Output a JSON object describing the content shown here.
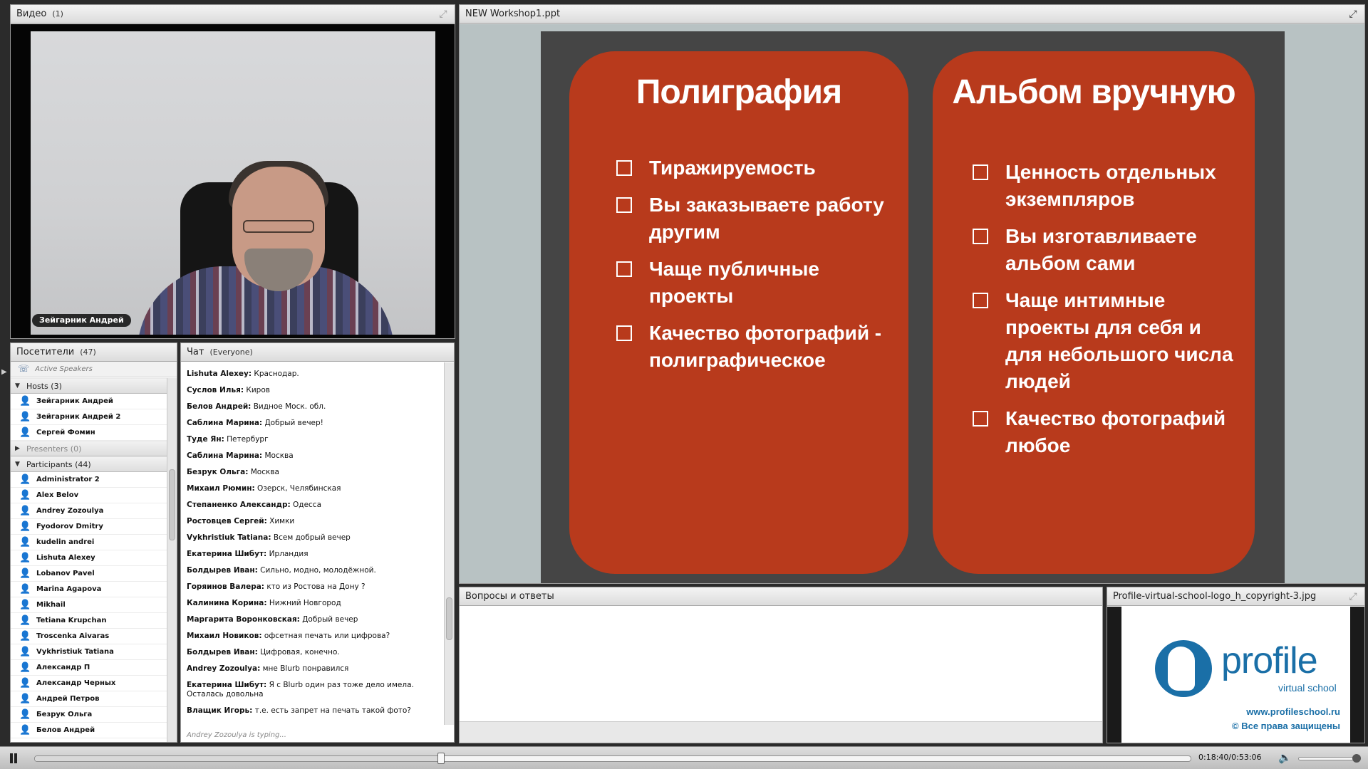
{
  "video": {
    "title": "Видео",
    "count": "(1)",
    "speaker_name": "Зейгарник Андрей"
  },
  "share": {
    "title": "NEW Workshop1.ppt",
    "slide": {
      "left_title": "Полиграфия",
      "left_items": [
        "Тиражируемость",
        "Вы заказываете работу другим",
        "Чаще публичные проекты",
        "Качество фотографий - полиграфическое"
      ],
      "right_title": "Альбом вручную",
      "right_items": [
        "Ценность отдельных экземпляров",
        "Вы изготавливаете альбом сами",
        "Чаще интимные проекты для себя и для небольшого числа людей",
        "Качество фотографий любое"
      ],
      "card_color": "#b83a1c"
    }
  },
  "attendees": {
    "title": "Посетители",
    "count": "(47)",
    "active_speakers": "Active Speakers",
    "hosts_label": "Hosts (3)",
    "hosts": [
      "Зейгарник Андрей",
      "Зейгарник Андрей 2",
      "Сергей Фомин"
    ],
    "presenters_label": "Presenters (0)",
    "participants_label": "Participants (44)",
    "participants": [
      "Administrator 2",
      "Alex Belov",
      "Andrey Zozoulya",
      "Fyodorov Dmitry",
      "kudelin andrei",
      "Lishuta Alexey",
      "Lobanov Pavel",
      "Marina Agapova",
      "Mikhail",
      "Tetiana Krupchan",
      "Troscenka Aivaras",
      "Vykhristiuk Tatiana",
      "Александр П",
      "Александр Черных",
      "Андрей Петров",
      "Безрук Ольга",
      "Белов Андрей"
    ]
  },
  "chat": {
    "title": "Чат",
    "scope": "(Everyone)",
    "messages": [
      {
        "author": "Lishuta Alexey:",
        "text": " Краснодар."
      },
      {
        "author": "Суслов Илья:",
        "text": " Киров"
      },
      {
        "author": "Белов Андрей:",
        "text": " Видное Моск. обл."
      },
      {
        "author": "Саблина Марина:",
        "text": " Добрый вечер!"
      },
      {
        "author": "Туде Ян:",
        "text": " Петербург"
      },
      {
        "author": "Саблина Марина:",
        "text": " Москва"
      },
      {
        "author": "Безрук Ольга:",
        "text": " Москва"
      },
      {
        "author": "Михаил Рюмин:",
        "text": " Озерск, Челябинская"
      },
      {
        "author": "Степаненко Александр:",
        "text": " Одесса"
      },
      {
        "author": "Ростовцев Сергей:",
        "text": " Химки"
      },
      {
        "author": "Vykhristiuk Tatiana:",
        "text": " Всем добрый вечер"
      },
      {
        "author": "Екатерина Шибут:",
        "text": " Ирландия"
      },
      {
        "author": "Болдырев Иван:",
        "text": " Сильно, модно, молодёжной."
      },
      {
        "author": "Горяинов Валера:",
        "text": " кто из Ростова на Дону ?"
      },
      {
        "author": "Калинина Корина:",
        "text": " Нижний Новгород"
      },
      {
        "author": "Маргарита Воронковская:",
        "text": " Добрый вечер"
      },
      {
        "author": "Михаил Новиков:",
        "text": " офсетная печать или цифрова?"
      },
      {
        "author": "Болдырев Иван:",
        "text": " Цифровая, конечно."
      },
      {
        "author": "Andrey Zozoulya:",
        "text": " мне Blurb понравился"
      },
      {
        "author": "Екатерина Шибут:",
        "text": " Я с Blurb один раз тоже дело имела. Осталась довольна"
      },
      {
        "author": "Влащик Игорь:",
        "text": " т.е. есть запрет на печать такой фото?"
      }
    ],
    "typing": "Andrey Zozoulya is typing..."
  },
  "qa": {
    "title": "Вопросы и ответы"
  },
  "logo_pod": {
    "title": "Profile-virtual-school-logo_h_copyright-3.jpg",
    "word": "profile",
    "sub": "virtual school",
    "url": "www.profileschool.ru",
    "copyright": "© Все права защищены",
    "brand_color": "#1a6fa7"
  },
  "playback": {
    "time": "0:18:40/0:53:06",
    "progress": 0.3515,
    "volume": 0.96
  }
}
